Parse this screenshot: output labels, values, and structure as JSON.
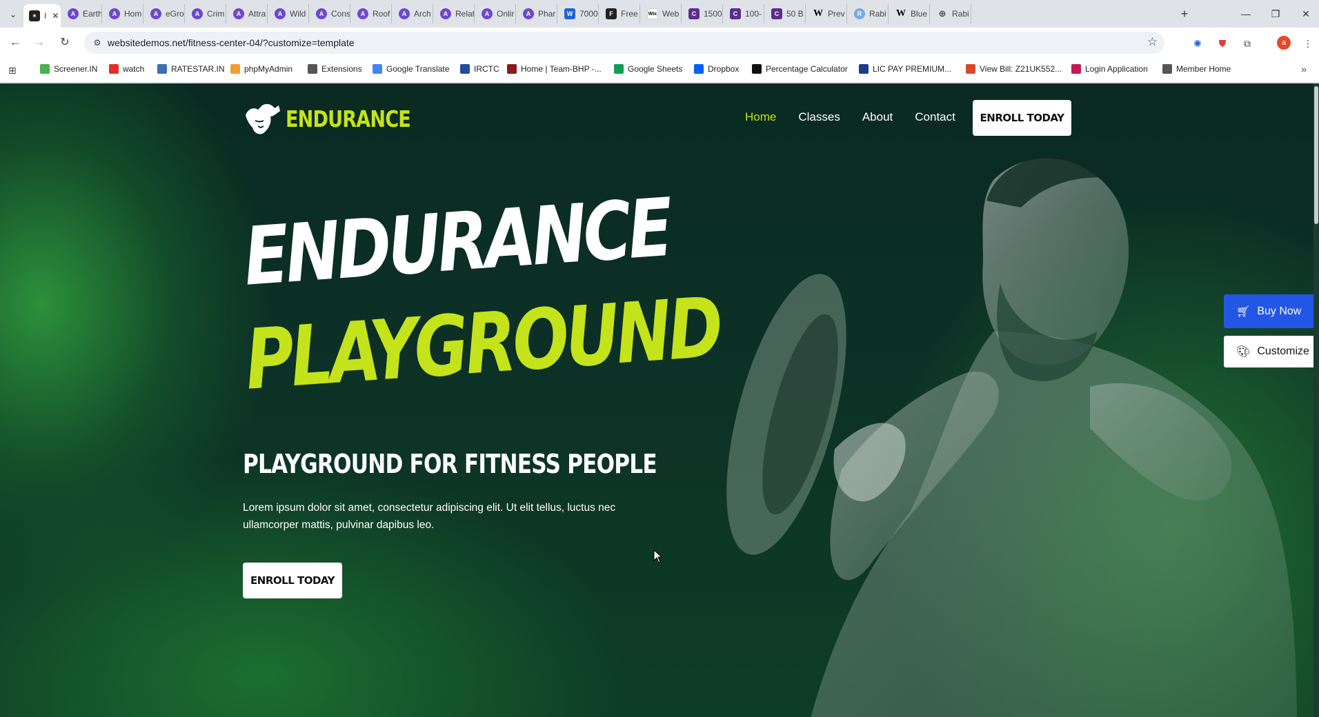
{
  "browser": {
    "tabs": [
      {
        "title": "I",
        "favicon": "endurance-favicon",
        "active": true
      },
      {
        "title": "Earth",
        "favicon": "astra-icon"
      },
      {
        "title": "Hom",
        "favicon": "astra-icon"
      },
      {
        "title": "eGro",
        "favicon": "astra-icon"
      },
      {
        "title": "Crim",
        "favicon": "astra-icon"
      },
      {
        "title": "Attra",
        "favicon": "astra-icon"
      },
      {
        "title": "Wild",
        "favicon": "astra-icon"
      },
      {
        "title": "Cons",
        "favicon": "astra-icon"
      },
      {
        "title": "Roof",
        "favicon": "astra-icon"
      },
      {
        "title": "Arch",
        "favicon": "astra-icon"
      },
      {
        "title": "Relat",
        "favicon": "astra-icon"
      },
      {
        "title": "Onlir",
        "favicon": "astra-icon"
      },
      {
        "title": "Phar",
        "favicon": "astra-icon"
      },
      {
        "title": "7000",
        "favicon": "word-icon"
      },
      {
        "title": "Free",
        "favicon": "framer-icon"
      },
      {
        "title": "Web",
        "favicon": "wix-icon"
      },
      {
        "title": "1500",
        "favicon": "canva-icon"
      },
      {
        "title": "100-",
        "favicon": "canva-icon"
      },
      {
        "title": "50 B",
        "favicon": "canva-icon"
      },
      {
        "title": "Prev",
        "favicon": "wikipedia-icon"
      },
      {
        "title": "Rabi",
        "favicon": "rabbit-icon"
      },
      {
        "title": "Blue",
        "favicon": "wikipedia-icon"
      },
      {
        "title": "Rabi",
        "favicon": "globe-icon"
      }
    ],
    "new_tab": "+",
    "url": "websitedemos.net/fitness-center-04/?customize=template",
    "profile_initial": "a",
    "bookmarks": [
      {
        "label": "Screener.IN",
        "icon": "bar-chart-icon",
        "color": "#4caf50"
      },
      {
        "label": "watch",
        "icon": "youtube-icon",
        "color": "#e52d27"
      },
      {
        "label": "RATESTAR.IN",
        "icon": "ratestar-icon",
        "color": "#3a6fb0"
      },
      {
        "label": "phpMyAdmin",
        "icon": "phpmyadmin-icon",
        "color": "#f0a030"
      },
      {
        "label": "Extensions",
        "icon": "puzzle-icon",
        "color": "#555555"
      },
      {
        "label": "Google Translate",
        "icon": "translate-icon",
        "color": "#4285f4"
      },
      {
        "label": "IRCTC",
        "icon": "irctc-icon",
        "color": "#1f4e9e"
      },
      {
        "label": "Home | Team-BHP -...",
        "icon": "teambhp-icon",
        "color": "#8b1a1a"
      },
      {
        "label": "Google Sheets",
        "icon": "sheets-icon",
        "color": "#0f9d58"
      },
      {
        "label": "Dropbox",
        "icon": "dropbox-icon",
        "color": "#0061fe"
      },
      {
        "label": "Percentage Calculator",
        "icon": "percent-icon",
        "color": "#111111"
      },
      {
        "label": "LIC PAY PREMIUM...",
        "icon": "lic-icon",
        "color": "#1a3d8f"
      },
      {
        "label": "View Bill: Z21UK552...",
        "icon": "bill-icon",
        "color": "#d64a2a"
      },
      {
        "label": "Login Application",
        "icon": "login-icon",
        "color": "#c2185b"
      },
      {
        "label": "Member Home",
        "icon": "globe-icon",
        "color": "#555555"
      }
    ]
  },
  "site": {
    "logo_text": "ENDURANCE",
    "nav": [
      "Home",
      "Classes",
      "About",
      "Contact"
    ],
    "header_cta": "ENROLL TODAY",
    "hero_line1": "ENDURANCE",
    "hero_line2": "PLAYGROUND",
    "hero_subtitle": "PLAYGROUND FOR FITNESS PEOPLE",
    "hero_paragraph": "Lorem ipsum dolor sit amet, consectetur adipiscing elit. Ut elit tellus, luctus nec ullamcorper mattis, pulvinar dapibus leo.",
    "hero_cta": "ENROLL TODAY",
    "buy_now": "Buy Now",
    "customize": "Customize",
    "accent_color": "#c5e31a",
    "buy_now_color": "#2456e6"
  }
}
